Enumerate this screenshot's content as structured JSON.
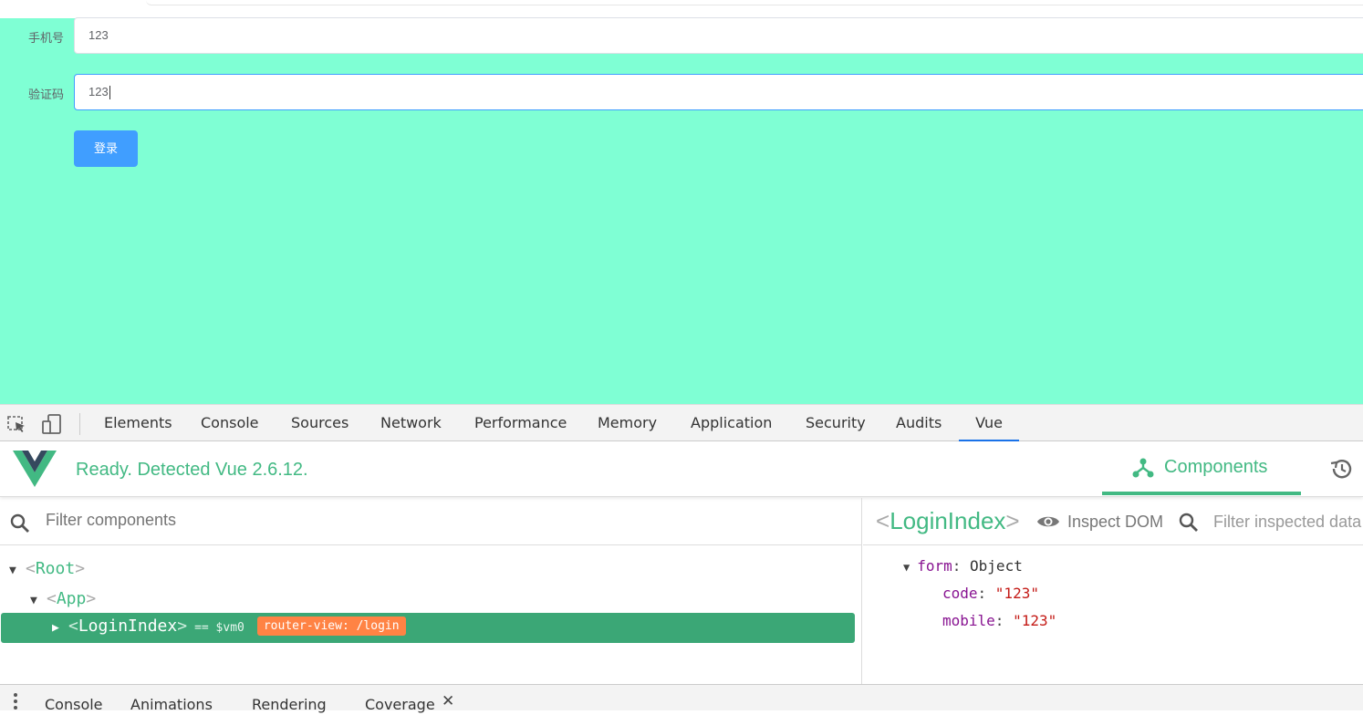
{
  "page": {
    "form": {
      "mobile_label": "手机号",
      "mobile_value": "123",
      "code_label": "验证码",
      "code_value": "123",
      "submit_label": "登录"
    },
    "colors": {
      "background": "#7fffd4",
      "primary": "#409eff"
    }
  },
  "devtools": {
    "tabs": [
      "Elements",
      "Console",
      "Sources",
      "Network",
      "Performance",
      "Memory",
      "Application",
      "Security",
      "Audits",
      "Vue"
    ],
    "active_tab": "Vue",
    "vue": {
      "status": "Ready. Detected Vue 2.6.12.",
      "nav_tab": "Components",
      "filter_placeholder": "Filter components",
      "tree": {
        "root": "Root",
        "app": "App",
        "login": "LoginIndex",
        "vm_label": "== $vm0",
        "router_badge": "router-view: /login"
      },
      "inspector": {
        "selected": "LoginIndex",
        "inspect_dom_label": "Inspect DOM",
        "filter_placeholder": "Filter inspected data",
        "state": {
          "form_key": "form",
          "form_type": "Object",
          "code_key": "code",
          "code_value": "\"123\"",
          "mobile_key": "mobile",
          "mobile_value": "\"123\""
        }
      },
      "colors": {
        "vue_green": "#42b983",
        "selected_row": "#3ba776",
        "badge": "#ff8344"
      }
    },
    "drawer_tabs": [
      "Console",
      "Animations",
      "Rendering",
      "Coverage"
    ],
    "drawer_close": "✕"
  }
}
